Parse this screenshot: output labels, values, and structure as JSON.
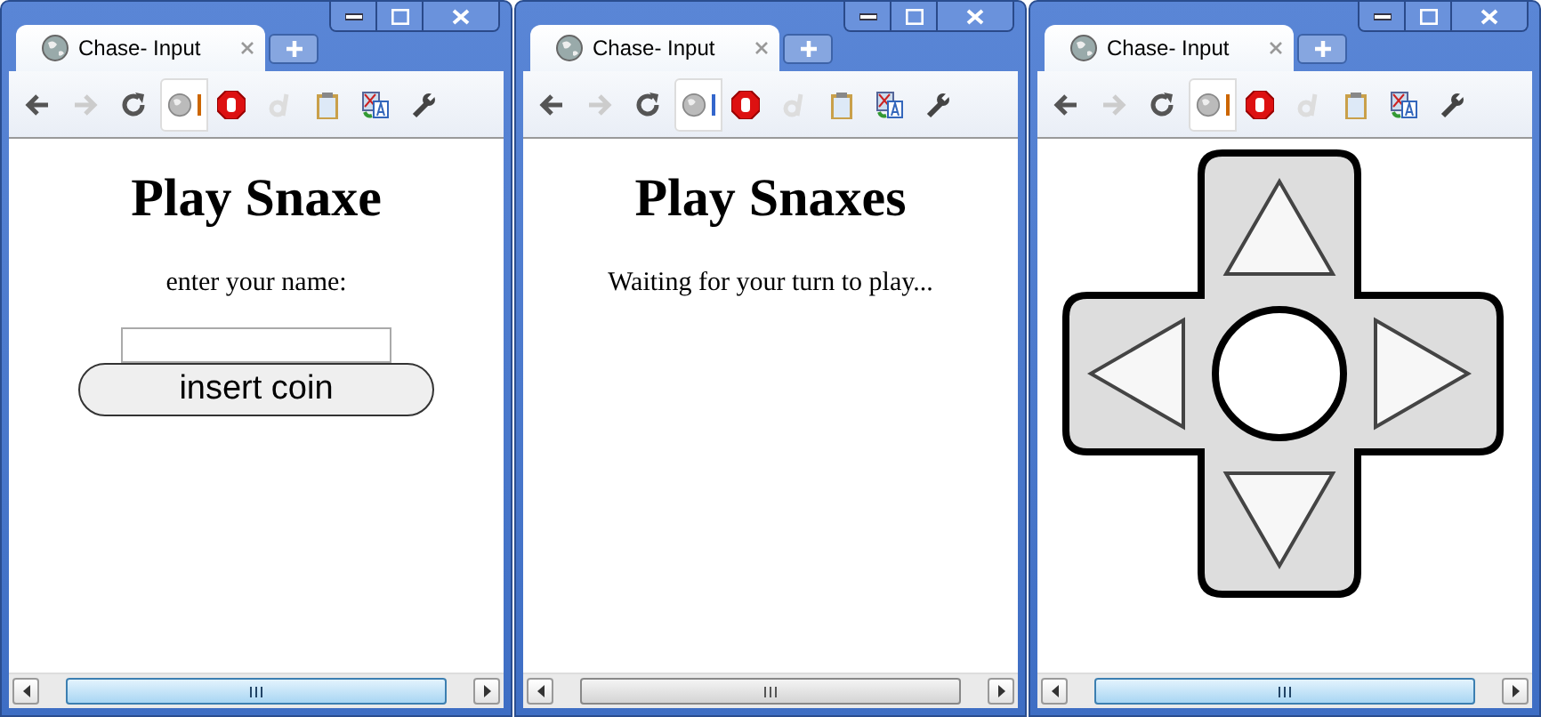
{
  "windows": [
    {
      "tab": {
        "title": "Chase- Input"
      },
      "focused": true,
      "page": {
        "kind": "name_entry",
        "heading": "Play Snaxe",
        "prompt": "enter your name:",
        "button": "insert coin"
      }
    },
    {
      "tab": {
        "title": "Chase- Input"
      },
      "focused": false,
      "page": {
        "kind": "waiting",
        "heading": "Play Snaxes",
        "message": "Waiting for your turn to play..."
      }
    },
    {
      "tab": {
        "title": "Chase- Input"
      },
      "focused": true,
      "page": {
        "kind": "dpad"
      }
    }
  ]
}
